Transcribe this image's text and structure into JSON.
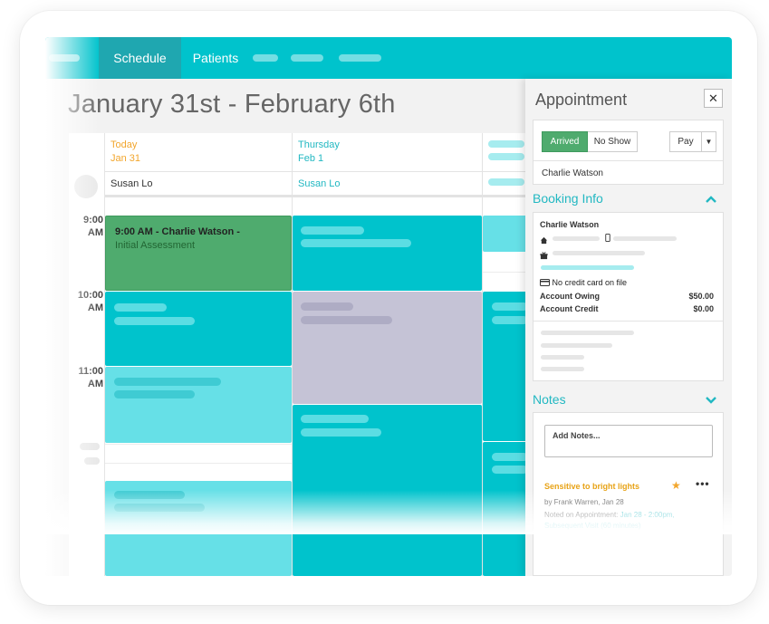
{
  "nav": {
    "tabs": [
      {
        "label": "Schedule",
        "active": true
      },
      {
        "label": "Patients",
        "active": false
      }
    ]
  },
  "schedule": {
    "week_title": "January 31st - February 6th",
    "columns": [
      {
        "day": "Today",
        "date": "Jan 31",
        "provider": "Susan Lo",
        "day_color": "#f2a62d"
      },
      {
        "day": "Thursday",
        "date": "Feb 1",
        "provider": "Susan Lo",
        "day_color": "#22b8c2"
      }
    ],
    "times": [
      {
        "hour": "9:00",
        "ampm": "AM"
      },
      {
        "hour": "10:00",
        "ampm": "AM"
      },
      {
        "hour": "11:00",
        "ampm": "AM"
      }
    ],
    "featured_appointment": {
      "title": "9:00 AM - Charlie Watson -",
      "subtitle": "Initial Assessment"
    }
  },
  "panel": {
    "title": "Appointment",
    "close_label": "✕",
    "status": {
      "arrived": "Arrived",
      "no_show": "No Show"
    },
    "pay_label": "Pay",
    "patient": "Charlie Watson",
    "booking": {
      "heading": "Booking Info",
      "name": "Charlie Watson",
      "credit_card": "No credit card on file",
      "account_owing_label": "Account Owing",
      "account_owing_value": "$50.00",
      "account_credit_label": "Account Credit",
      "account_credit_value": "$0.00"
    },
    "notes": {
      "heading": "Notes",
      "placeholder": "Add Notes...",
      "note_title": "Sensitive to bright lights",
      "note_by": "by Frank Warren, Jan 28",
      "note_on_prefix": "Noted on Appointment:",
      "note_on_link": "Jan 28 - 2:00pm, Subsequent Visit (60 minutes)"
    }
  },
  "colors": {
    "brand": "#00c3cc",
    "brand_dark": "#1fa7b0",
    "appt_teal": "#00c3cc",
    "appt_light": "#66e0e7",
    "appt_gray": "#c5c3d6",
    "arrived_green": "#4fab6e"
  }
}
